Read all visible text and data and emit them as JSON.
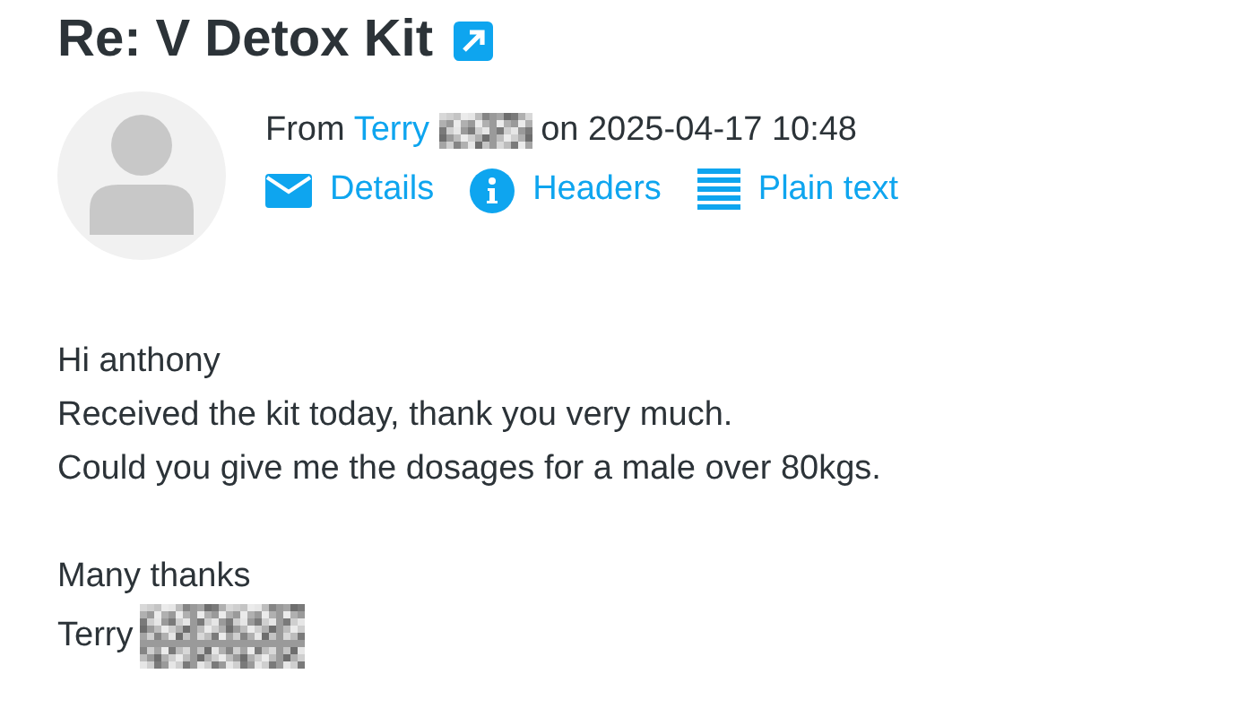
{
  "message": {
    "subject": "Re: V Detox Kit",
    "from": {
      "prefix": "From",
      "sender": "Terry",
      "suffix": "on 2025-04-17 10:48"
    },
    "actions": [
      {
        "kind": "envelope",
        "label": "Details"
      },
      {
        "kind": "info",
        "label": "Headers"
      },
      {
        "kind": "lines",
        "label": "Plain text"
      }
    ],
    "body": [
      [
        "Hi anthony",
        "Received the kit today, thank you very much.",
        "Could you give me the dosages for a male over 80kgs."
      ]
    ],
    "signature": {
      "closing": "Many thanks",
      "name": "Terry"
    }
  }
}
